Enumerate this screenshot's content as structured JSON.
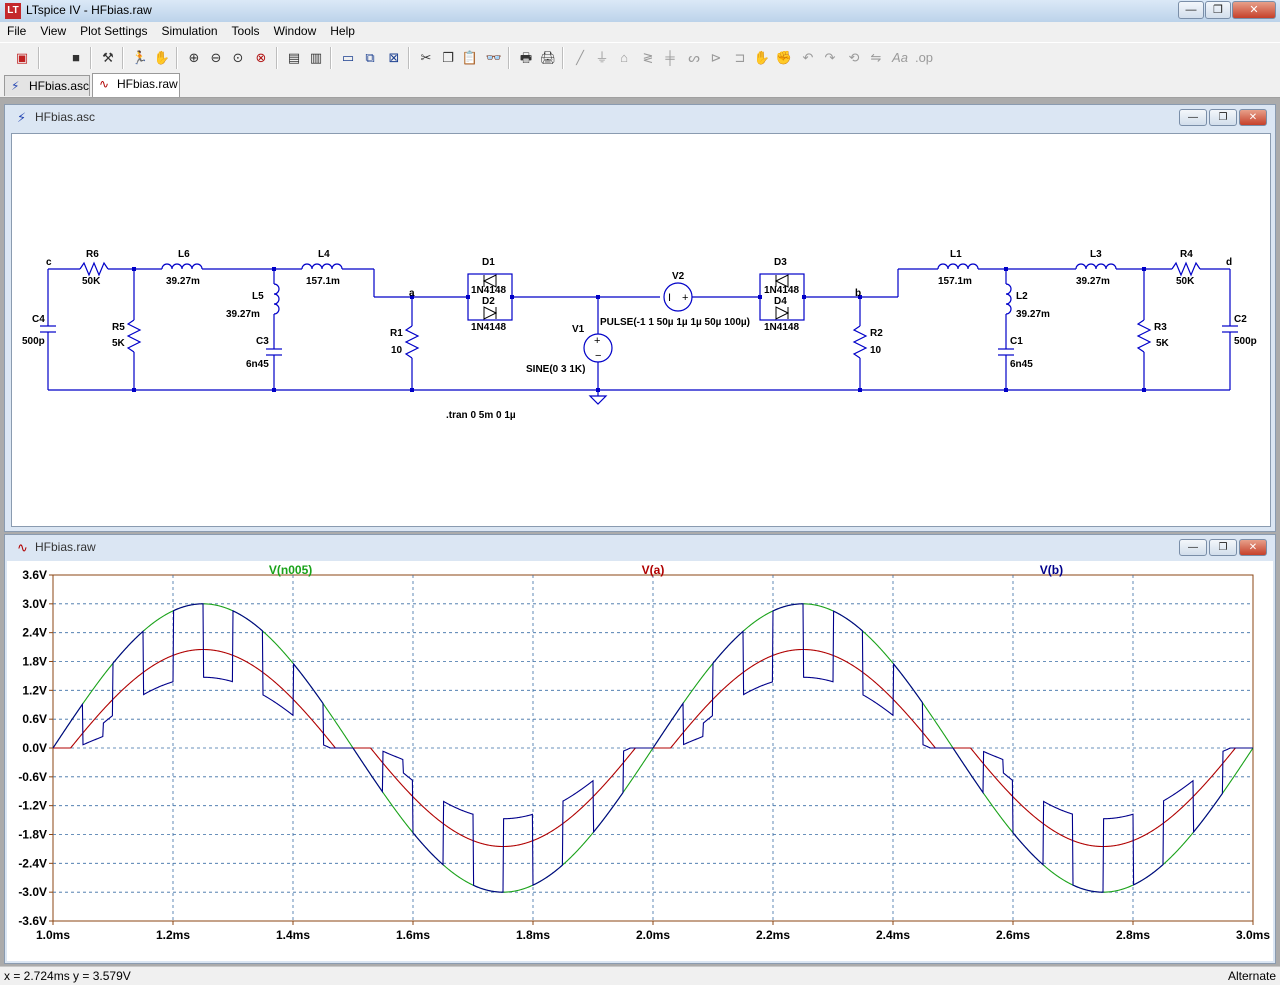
{
  "app": {
    "icon_text": "LT",
    "title": "LTspice IV - HFbias.raw",
    "win_min": "—",
    "win_max": "❐",
    "win_close": "✕"
  },
  "menu": [
    "File",
    "View",
    "Plot Settings",
    "Simulation",
    "Tools",
    "Window",
    "Help"
  ],
  "toolbar": {
    "icons": [
      "new-schematic-icon",
      "save-icon",
      "control-panel-icon",
      "run-icon",
      "halt-icon",
      "zoom-in-icon",
      "zoom-out-icon",
      "zoom-fit-icon",
      "zoom-cancel-icon",
      "autorange-icon",
      "plot-settings-icon",
      "tile-horizontal-icon",
      "cascade-icon",
      "close-all-icon",
      "cut-icon",
      "copy-icon",
      "paste-icon",
      "find-icon",
      "print-setup-icon",
      "print-icon",
      "wire-icon",
      "ground-icon",
      "label-icon",
      "resistor-icon",
      "capacitor-icon",
      "inductor-icon",
      "diode-icon",
      "component-icon",
      "move-icon",
      "drag-icon",
      "undo-icon",
      "redo-icon",
      "rotate-icon",
      "mirror-icon",
      "text-icon",
      "spice-directive-icon"
    ]
  },
  "tabs": [
    {
      "label": "HFbias.asc",
      "icon": "schematic-icon",
      "active": false
    },
    {
      "label": "HFbias.raw",
      "icon": "waveform-icon",
      "active": true
    }
  ],
  "schematic_window": {
    "title": "HFbias.asc",
    "directive": ".tran 0 5m 0 1µ",
    "labels": {
      "c": "c",
      "d": "d",
      "a": "a",
      "b": "b",
      "R6": "R6",
      "R6v": "50K",
      "L6": "L6",
      "L6v": "39.27m",
      "L4": "L4",
      "L4v": "157.1m",
      "D1": "D1",
      "D1v": "1N4148",
      "D2": "D2",
      "D2v": "1N4148",
      "V2": "V2",
      "D3": "D3",
      "D3v": "1N4148",
      "D4": "D4",
      "D4v": "1N4148",
      "L1": "L1",
      "L1v": "157.1m",
      "L3": "L3",
      "L3v": "39.27m",
      "R4": "R4",
      "R4v": "50K",
      "C4": "C4",
      "C4v": "500p",
      "R5": "R5",
      "R5v": "5K",
      "L5": "L5",
      "L5v": "39.27m",
      "C3": "C3",
      "C3v": "6n45",
      "R1": "R1",
      "R1v": "10",
      "V1": "V1",
      "V1v": "SINE(0 3 1K)",
      "V2v": "PULSE(-1 1 50µ 1µ 1µ 50µ 100µ)",
      "R2": "R2",
      "R2v": "10",
      "L2": "L2",
      "L2v": "39.27m",
      "C1": "C1",
      "C1v": "6n45",
      "R3": "R3",
      "R3v": "5K",
      "C2": "C2",
      "C2v": "500p"
    }
  },
  "waveform_window": {
    "title": "HFbias.raw"
  },
  "colors": {
    "trace_green": "#1aa21a",
    "trace_red": "#b00000",
    "trace_blue": "#00008b",
    "wire": "#0000c8",
    "grid": "#3a6ea5",
    "axis_frame": "#8b4513"
  },
  "chart_data": {
    "type": "line",
    "title": "",
    "xlabel": "",
    "ylabel": "",
    "x_unit": "ms",
    "xlim": [
      1.0,
      3.0
    ],
    "ylim": [
      -3.6,
      3.6
    ],
    "x_ticks": [
      "1.0ms",
      "1.2ms",
      "1.4ms",
      "1.6ms",
      "1.8ms",
      "2.0ms",
      "2.2ms",
      "2.4ms",
      "2.6ms",
      "2.8ms",
      "3.0ms"
    ],
    "y_ticks": [
      "3.6V",
      "3.0V",
      "2.4V",
      "1.8V",
      "1.2V",
      "0.6V",
      "0.0V",
      "-0.6V",
      "-1.2V",
      "-1.8V",
      "-2.4V",
      "-3.0V",
      "-3.6V"
    ],
    "grid": true,
    "series": [
      {
        "name": "V(n005)",
        "color": "#1aa21a",
        "shape": "sine",
        "amplitude": 3.0,
        "frequency_khz": 1
      },
      {
        "name": "V(a)",
        "color": "#b00000",
        "shape": "clipped-sine",
        "amplitude": 2.05,
        "frequency_khz": 1
      },
      {
        "name": "V(b)",
        "color": "#00008b",
        "shape": "chopped-sine",
        "amplitude": 3.0,
        "frequency_khz": 1,
        "chop_period_ms": 0.1
      }
    ]
  },
  "status": {
    "left": "x = 2.724ms    y = 3.579V",
    "right": "Alternate"
  }
}
